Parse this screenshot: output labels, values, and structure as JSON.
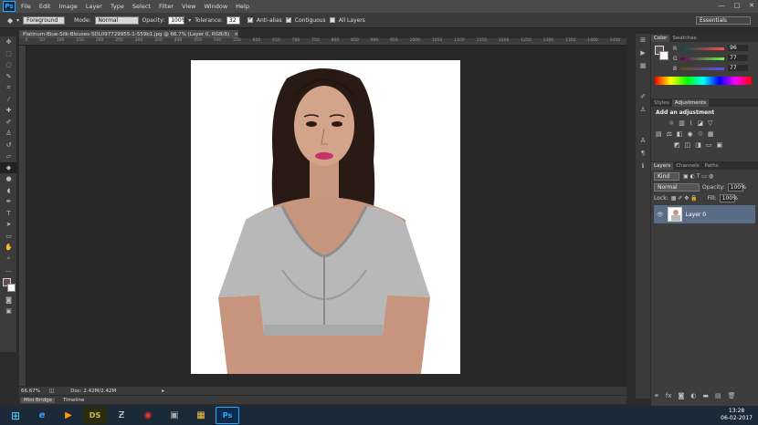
{
  "app": {
    "logo": "Ps",
    "title_menu": [
      "File",
      "Edit",
      "Image",
      "Layer",
      "Type",
      "Select",
      "Filter",
      "View",
      "Window",
      "Help"
    ],
    "window_controls": [
      "—",
      "□",
      "✕"
    ]
  },
  "options": {
    "foreground_label": "Foreground",
    "mode_label": "Mode:",
    "mode_value": "Normal",
    "opacity_label": "Opacity:",
    "opacity_value": "100%",
    "tolerance_label": "Tolerance:",
    "tolerance_value": "32",
    "antialias": "Anti-alias",
    "contiguous": "Contiguous",
    "all_layers": "All Layers",
    "workspace": "Essentials"
  },
  "document": {
    "tab_title": "Platinum-Blue-Silk-Blouses-SDL097729955-1-559b1.jpg @ 66.7% (Layer 0, RGB/8) *",
    "zoom": "66.67%",
    "doc_size": "Doc: 2.42M/2.42M",
    "ruler_ticks": [
      "0",
      "50",
      "100",
      "150",
      "200",
      "250",
      "300",
      "350",
      "400",
      "450",
      "500",
      "550",
      "600",
      "650",
      "700",
      "750",
      "800",
      "850",
      "900",
      "950",
      "1000",
      "1050",
      "1100",
      "1150",
      "1200",
      "1250",
      "1300",
      "1350",
      "1400",
      "1450"
    ]
  },
  "bottom_tabs": [
    "Mini Bridge",
    "Timeline"
  ],
  "color_panel": {
    "tabs": [
      "Color",
      "Swatches"
    ],
    "r_label": "R",
    "g_label": "G",
    "b_label": "B",
    "r": "96",
    "g": "77",
    "b": "77"
  },
  "adjustments_panel": {
    "tabs": [
      "Styles",
      "Adjustments"
    ],
    "heading": "Add an adjustment"
  },
  "layers_panel": {
    "tabs": [
      "Layers",
      "Channels",
      "Paths"
    ],
    "kind": "Kind",
    "blend": "Normal",
    "opacity_label": "Opacity:",
    "opacity_value": "100%",
    "lock_label": "Lock:",
    "fill_label": "Fill:",
    "fill_value": "100%",
    "layers": [
      {
        "name": "Layer 0"
      }
    ]
  },
  "taskbar": {
    "time": "13:28",
    "date": "06-02-2017"
  },
  "colors": {
    "accent": "#31a8ff",
    "selected_layer": "#5a6c86",
    "canvas_bg": "#282828"
  }
}
